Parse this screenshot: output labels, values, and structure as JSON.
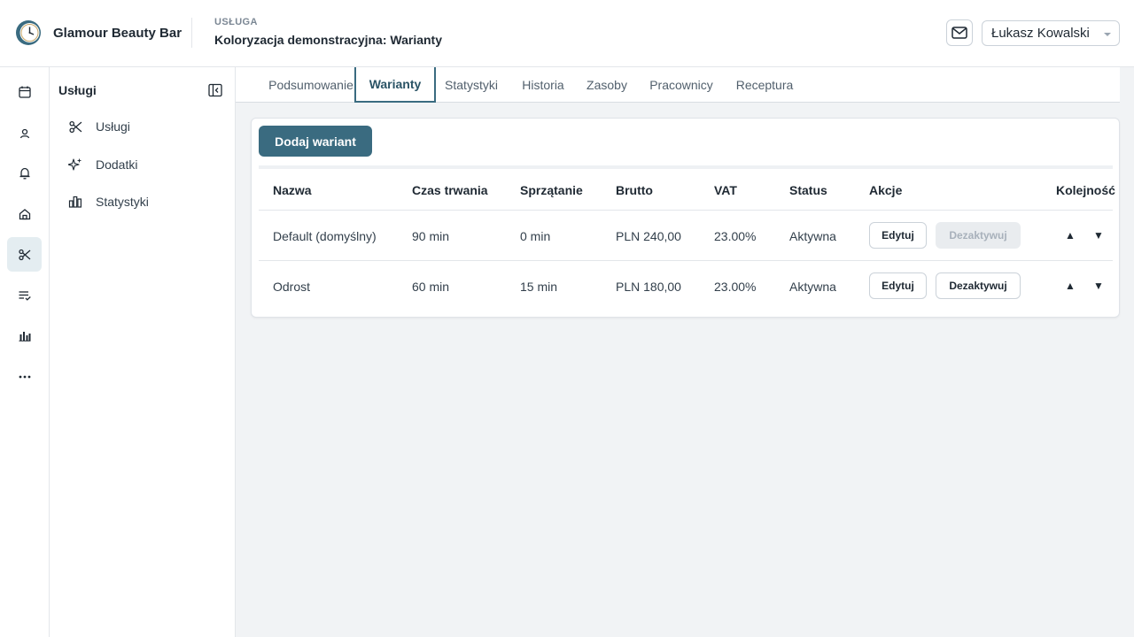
{
  "header": {
    "brand": "Glamour Beauty Bar",
    "kicker": "USŁUGA",
    "title": "Koloryzacja demonstracyjna: Warianty",
    "user": "Łukasz Kowalski"
  },
  "rail": {
    "items": [
      {
        "icon": "calendar-icon"
      },
      {
        "icon": "client-icon"
      },
      {
        "icon": "bell-icon"
      },
      {
        "icon": "home-icon"
      },
      {
        "icon": "scissors-icon",
        "active": true
      },
      {
        "icon": "checklist-icon"
      },
      {
        "icon": "bar-chart-icon"
      },
      {
        "icon": "more-icon"
      }
    ]
  },
  "sidenav": {
    "title": "Usługi",
    "items": [
      {
        "label": "Usługi",
        "icon": "scissors-icon"
      },
      {
        "label": "Dodatki",
        "icon": "sparkles-icon"
      },
      {
        "label": "Statystyki",
        "icon": "bar-chart-icon"
      }
    ]
  },
  "tabs": [
    {
      "label": "Podsumowanie"
    },
    {
      "label": "Warianty",
      "active": true
    },
    {
      "label": "Statystyki"
    },
    {
      "label": "Historia"
    },
    {
      "label": "Zasoby"
    },
    {
      "label": "Pracownicy"
    },
    {
      "label": "Receptura"
    }
  ],
  "variants": {
    "add_label": "Dodaj wariant",
    "columns": [
      "Nazwa",
      "Czas trwania",
      "Sprzątanie",
      "Brutto",
      "VAT",
      "Status",
      "Akcje",
      "Kolejność"
    ],
    "rows": [
      {
        "name": "Default (domyślny)",
        "duration": "90 min",
        "cleanup": "0 min",
        "gross": "PLN 240,00",
        "vat": "23.00%",
        "status": "Aktywna",
        "edit": "Edytuj",
        "deactivate": "Dezaktywuj",
        "deactivate_disabled": true,
        "up": "▲",
        "down": "▼"
      },
      {
        "name": "Odrost",
        "duration": "60 min",
        "cleanup": "15 min",
        "gross": "PLN 180,00",
        "vat": "23.00%",
        "status": "Aktywna",
        "edit": "Edytuj",
        "deactivate": "Dezaktywuj",
        "deactivate_disabled": false,
        "up": "▲",
        "down": "▼"
      }
    ]
  },
  "colors": {
    "accent": "#3a6b80",
    "active_bg": "#e4edf1",
    "main_bg": "#f1f3f5"
  }
}
